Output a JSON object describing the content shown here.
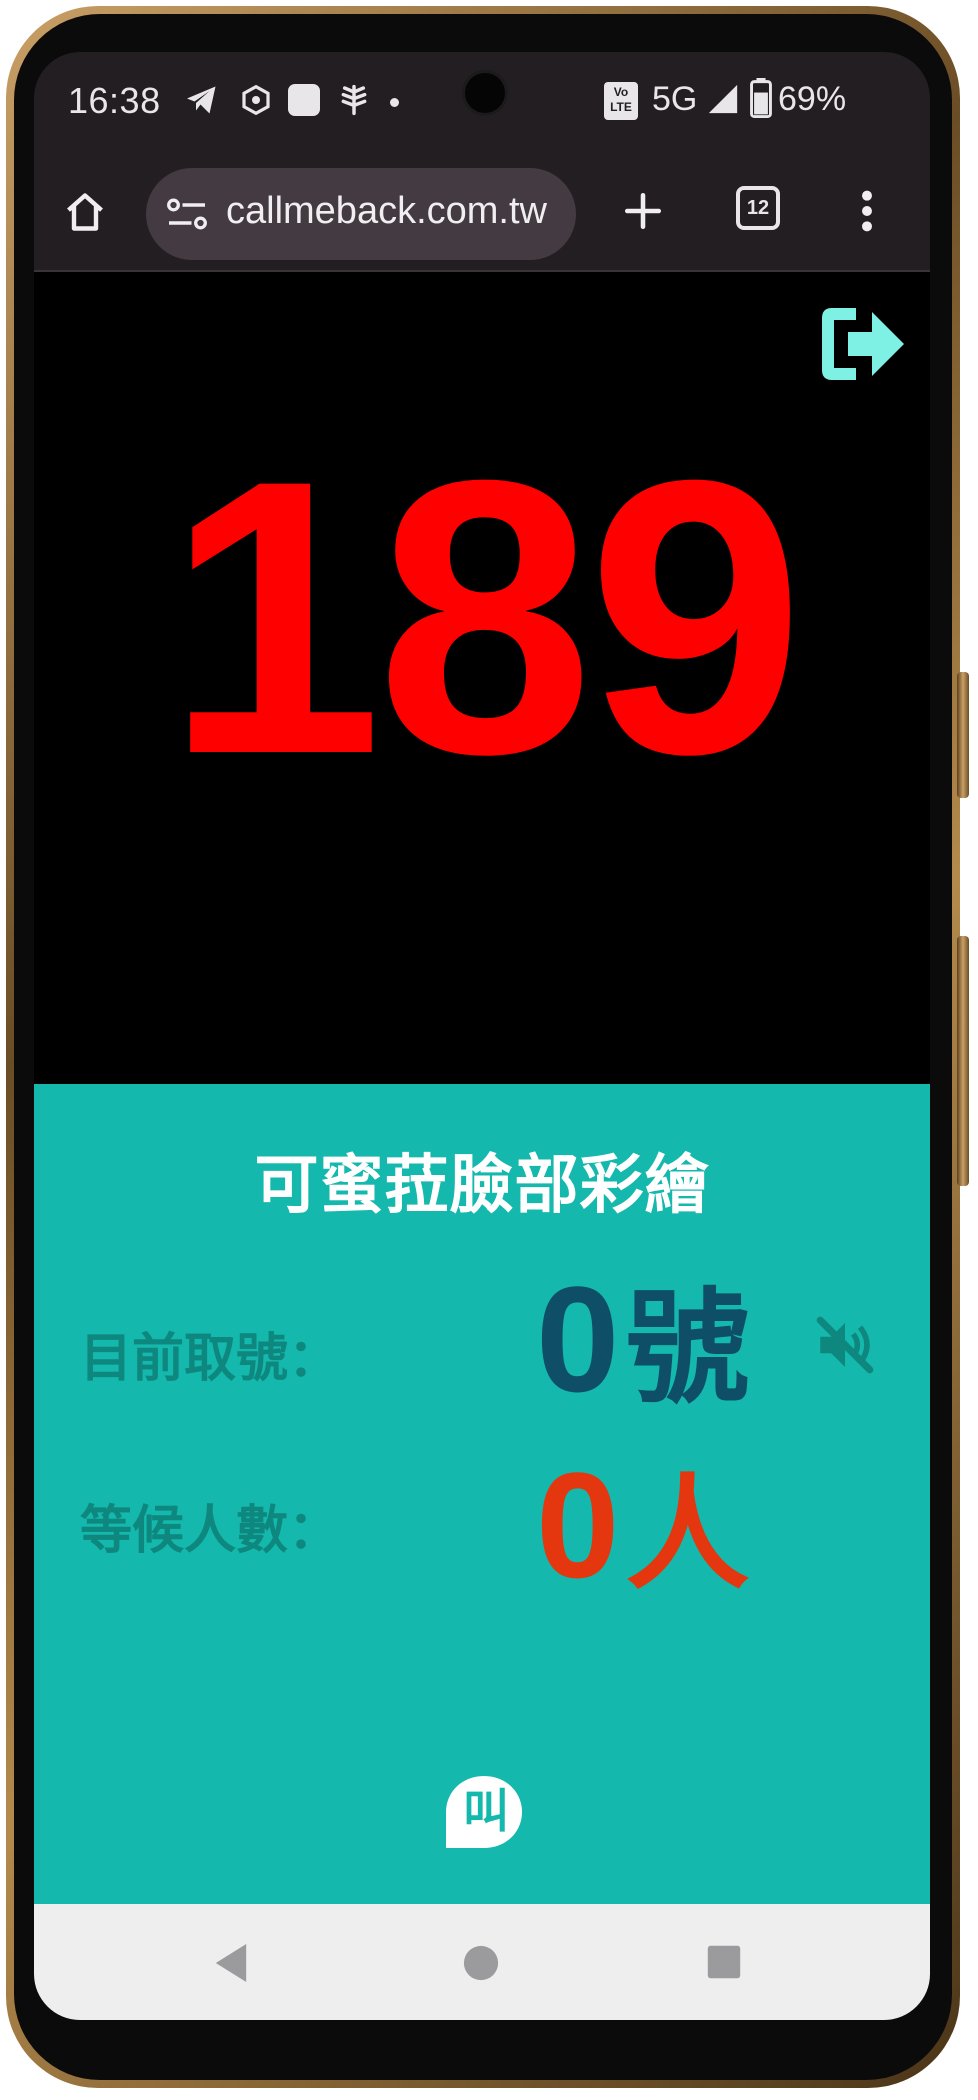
{
  "status_bar": {
    "time": "16:38",
    "network": "5G",
    "volte": "Vo LTE",
    "battery": "69%"
  },
  "browser": {
    "url": "callmeback.com.tw",
    "tab_count": "12",
    "icons": [
      "home-icon",
      "site-settings-icon",
      "new-tab-icon",
      "tab-switcher-icon",
      "more-menu-icon"
    ]
  },
  "queue": {
    "now_serving": "189",
    "shop_name": "可蜜菈臉部彩繪",
    "current_label": "目前取號：",
    "current_number": "0",
    "current_unit": "號",
    "waiting_label": "等候人數：",
    "waiting_count": "0",
    "waiting_unit": "人",
    "logo_text": "叫"
  },
  "colors": {
    "number_red": "#ff0000",
    "panel_teal": "#14b8ac",
    "current_navy": "#0e4e66",
    "waiting_orange": "#e4370f",
    "exit_icon": "#7ef0e4"
  }
}
